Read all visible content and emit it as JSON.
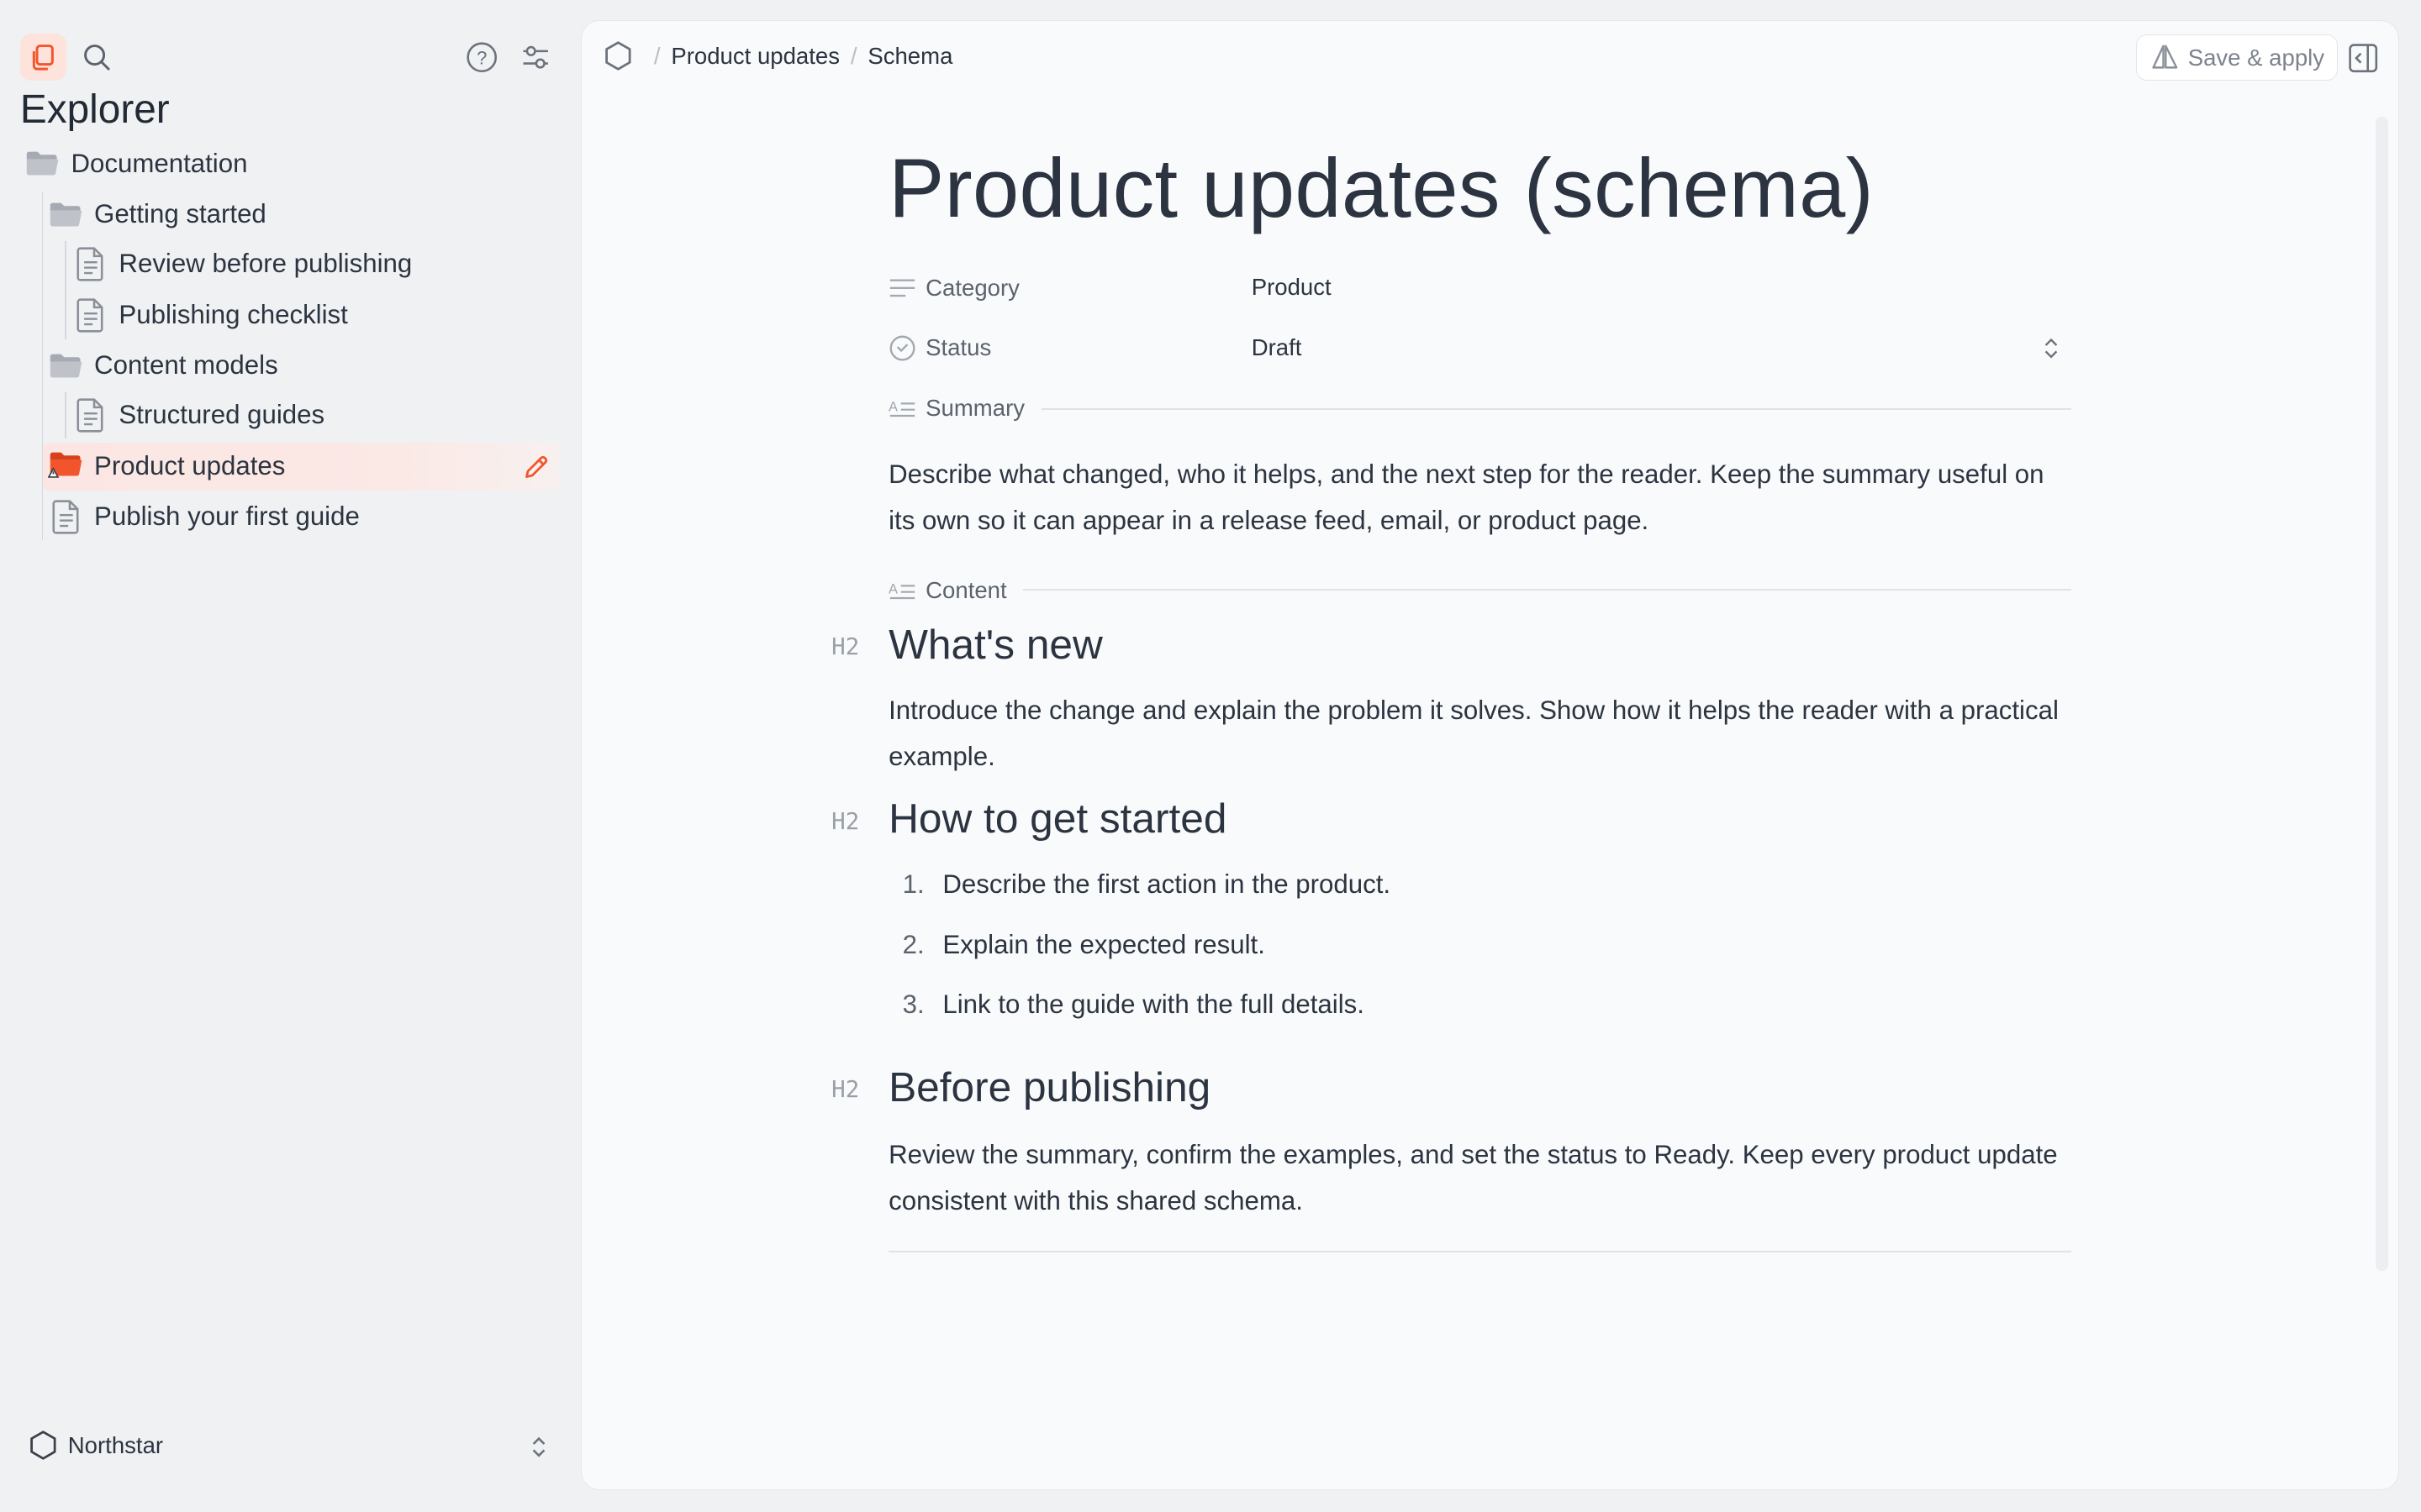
{
  "sidebar": {
    "title": "Explorer",
    "icons": [
      "files-icon",
      "search-icon",
      "help-icon",
      "settings-sliders-icon"
    ],
    "tree": [
      {
        "label": "Documentation",
        "type": "folder"
      },
      {
        "label": "Getting started",
        "type": "folder"
      },
      {
        "label": "Review before publishing",
        "type": "document"
      },
      {
        "label": "Publishing checklist",
        "type": "document"
      },
      {
        "label": "Content models",
        "type": "folder"
      },
      {
        "label": "Structured guides",
        "type": "document"
      },
      {
        "label": "Product updates",
        "type": "folder",
        "selected": true
      },
      {
        "label": "Publish your first guide",
        "type": "document"
      }
    ],
    "workspace": "Northstar"
  },
  "breadcrumb": {
    "items": [
      "Product updates",
      "Schema"
    ]
  },
  "toolbar": {
    "save_label": "Save & apply"
  },
  "document": {
    "title": "Product updates (schema)",
    "properties": {
      "category_label": "Category",
      "category_value": "Product",
      "status_label": "Status",
      "status_value": "Draft"
    },
    "summary_label": "Summary",
    "summary_text": "Describe what changed, who it helps, and the next step for the reader. Keep the summary useful on its own so it can appear in a release feed, email, or product page.",
    "content_label": "Content",
    "heading_tag": "H2",
    "sections": [
      {
        "heading": "What's new",
        "text": "Introduce the change and explain the problem it solves. Show how it helps the reader with a practical example."
      },
      {
        "heading": "How to get started",
        "list": [
          "Describe the first action in the product.",
          "Explain the expected result.",
          "Link to the guide with the full details."
        ]
      },
      {
        "heading": "Before publishing",
        "text": "Review the summary, confirm the examples, and set the status to Ready. Keep every product update consistent with this shared schema."
      }
    ]
  },
  "colors": {
    "accent": "#f2552c",
    "text": "#2b3440",
    "muted": "#5b636e"
  }
}
